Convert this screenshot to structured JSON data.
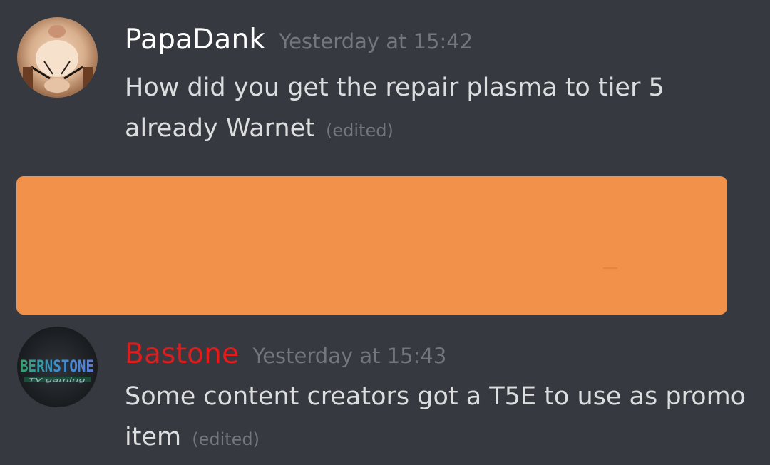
{
  "messages": [
    {
      "username": "PapaDank",
      "timestamp": "Yesterday at 15:42",
      "content": "How did you get the repair plasma to tier 5 already Warnet",
      "edited": "(edited)",
      "avatar_icon": "hamster-avatar",
      "name_color": "#ffffff"
    },
    {
      "username": "Bastone",
      "timestamp": "Yesterday at 15:43",
      "content": "Some content creators got a T5E to use as promo item",
      "edited": "(edited)",
      "avatar_icon": "bernstone-gaming-logo-avatar",
      "avatar_logo": "BERNSTONE",
      "avatar_logo_sub": "TV gaming",
      "name_color": "#e01c1c"
    }
  ],
  "redaction": {
    "color": "#f2924a"
  },
  "colors": {
    "background": "#36393f",
    "text": "#dcddde",
    "muted": "#72767d"
  }
}
